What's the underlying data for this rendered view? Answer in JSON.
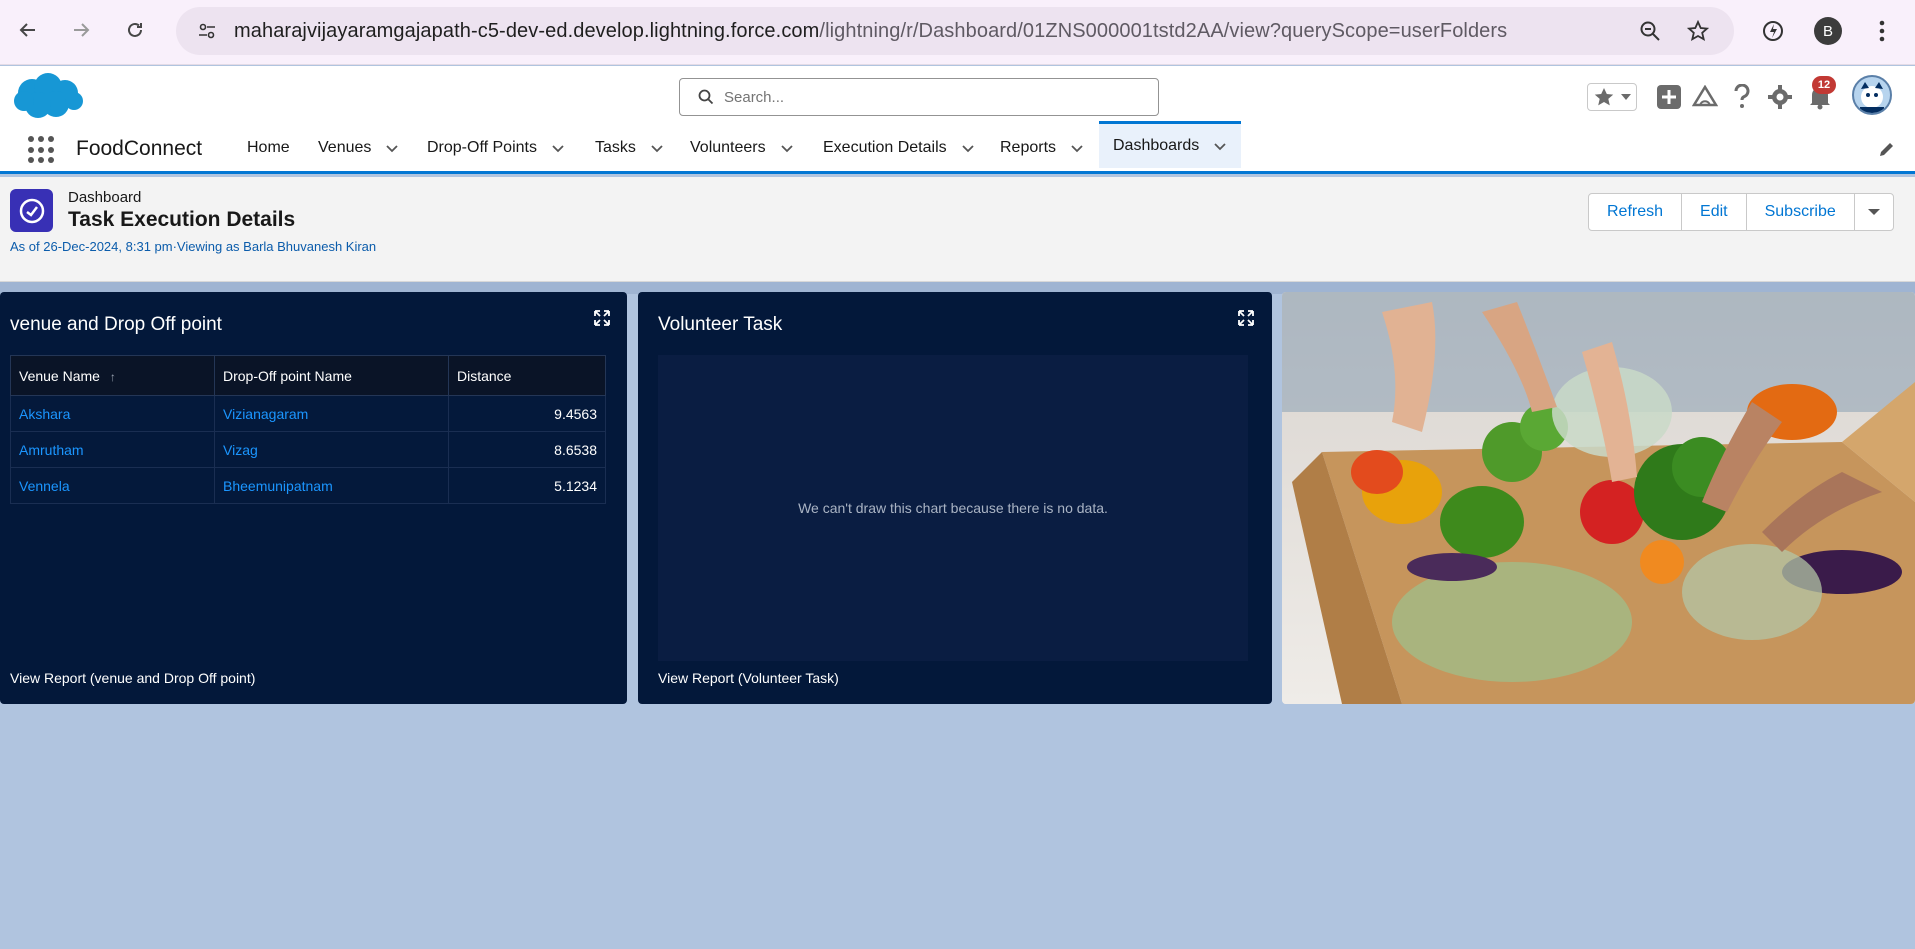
{
  "browser": {
    "url_domain": "maharajvijayaramgajapath-c5-dev-ed.develop.lightning.force.com",
    "url_path": "/lightning/r/Dashboard/01ZNS000001tstd2AA/view?queryScope=userFolders",
    "profile_initial": "B"
  },
  "header": {
    "search_placeholder": "Search...",
    "notification_count": "12"
  },
  "nav": {
    "app_name": "FoodConnect",
    "items": [
      {
        "label": "Home"
      },
      {
        "label": "Venues"
      },
      {
        "label": "Drop-Off Points"
      },
      {
        "label": "Tasks"
      },
      {
        "label": "Volunteers"
      },
      {
        "label": "Execution Details"
      },
      {
        "label": "Reports"
      },
      {
        "label": "Dashboards"
      }
    ]
  },
  "dashboard": {
    "type_label": "Dashboard",
    "title": "Task Execution Details",
    "meta": "As of 26-Dec-2024, 8:31 pm·Viewing as Barla Bhuvanesh Kiran",
    "buttons": {
      "refresh": "Refresh",
      "edit": "Edit",
      "subscribe": "Subscribe"
    }
  },
  "widgets": {
    "venue": {
      "title": "venue and Drop Off point",
      "columns": [
        "Venue Name",
        "Drop-Off point Name",
        "Distance"
      ],
      "sort_indicator": "↑",
      "rows": [
        {
          "venue": "Akshara",
          "dropoff": "Vizianagaram",
          "distance": "9.4563"
        },
        {
          "venue": "Amrutham",
          "dropoff": "Vizag",
          "distance": "8.6538"
        },
        {
          "venue": "Vennela",
          "dropoff": "Bheemunipatnam",
          "distance": "5.1234"
        }
      ],
      "view_report": "View Report (venue and Drop Off point)"
    },
    "volunteer": {
      "title": "Volunteer Task",
      "no_data": "We can't draw this chart because there is no data.",
      "view_report": "View Report (Volunteer Task)"
    }
  },
  "colors": {
    "brand_blue": "#0176d3",
    "widget_bg": "#03183a",
    "canvas_bg": "#b0c4df",
    "link_blue": "#1b96ff"
  }
}
